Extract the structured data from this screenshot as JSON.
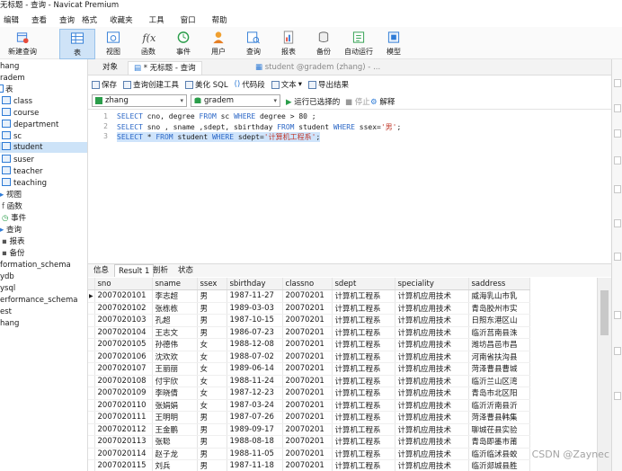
{
  "window": {
    "title": "无标题 - 查询 - Navicat Premium"
  },
  "menu": [
    "编辑",
    "查看",
    "查询",
    "格式",
    "收藏夹",
    "工具",
    "窗口",
    "帮助"
  ],
  "toolbar": {
    "new_query": "新建查询",
    "buttons": [
      "表",
      "视图",
      "函数",
      "事件",
      "用户",
      "查询",
      "报表",
      "备份",
      "自动运行",
      "模型"
    ]
  },
  "tree": {
    "items": [
      "zhang",
      "gradem",
      "表",
      "class",
      "course",
      "department",
      "sc",
      "student",
      "suser",
      "teacher",
      "teaching",
      "视图",
      "函数",
      "事件",
      "查询",
      "报表",
      "备份",
      "information_schema",
      "mydb",
      "mysql",
      "performance_schema",
      "test",
      "zhang"
    ],
    "shown": [
      "hang",
      "radem",
      "表",
      "class",
      "course",
      "department",
      "sc",
      "student",
      "suser",
      "teacher",
      "teaching",
      "视图",
      "函数",
      "事件",
      "查询",
      "报表",
      "备份",
      "formation_schema",
      "ydb",
      "ysql",
      "erformance_schema",
      "est",
      "hang"
    ]
  },
  "tabs": {
    "objects": "对象",
    "query": "* 无标题 - 查询",
    "table": "student @gradem (zhang) - ..."
  },
  "query_toolbar": {
    "save": "保存",
    "builder": "查询创建工具",
    "beautify": "美化 SQL",
    "snippet": "代码段",
    "text": "文本",
    "export": "导出结果"
  },
  "connection": {
    "conn": "zhang",
    "db": "gradem",
    "run": "运行已选择的",
    "stop": "停止",
    "explain": "解释"
  },
  "editor": {
    "lines": [
      {
        "n": "1",
        "text": "SELECT cno, degree FROM sc WHERE degree > 80 ;"
      },
      {
        "n": "2",
        "text": "SELECT sno , sname ,sdept, sbirthday FROM student WHERE ssex='男';"
      },
      {
        "n": "3",
        "text": "SELECT * FROM student WHERE sdept='计算机工程系';"
      }
    ]
  },
  "result_tabs": [
    "信息",
    "Result 1",
    "剖析",
    "状态"
  ],
  "grid": {
    "columns": [
      "sno",
      "sname",
      "ssex",
      "sbirthday",
      "classno",
      "sdept",
      "speciality",
      "saddress"
    ],
    "rows": [
      [
        "2007020101",
        "李志超",
        "男",
        "1987-11-27",
        "20070201",
        "计算机工程系",
        "计算机应用技术",
        "威海乳山市乳"
      ],
      [
        "2007020102",
        "张栋栋",
        "男",
        "1989-03-03",
        "20070201",
        "计算机工程系",
        "计算机应用技术",
        "青岛胶州市实"
      ],
      [
        "2007020103",
        "孔超",
        "男",
        "1987-10-15",
        "20070201",
        "计算机工程系",
        "计算机应用技术",
        "日照东港区山"
      ],
      [
        "2007020104",
        "王志文",
        "男",
        "1986-07-23",
        "20070201",
        "计算机工程系",
        "计算机应用技术",
        "临沂莒南县洙"
      ],
      [
        "2007020105",
        "孙德伟",
        "女",
        "1988-12-08",
        "20070201",
        "计算机工程系",
        "计算机应用技术",
        "潍坊昌邑市昌"
      ],
      [
        "2007020106",
        "沈欢欢",
        "女",
        "1988-07-02",
        "20070201",
        "计算机工程系",
        "计算机应用技术",
        "河南省扶沟县"
      ],
      [
        "2007020107",
        "王丽丽",
        "女",
        "1989-06-14",
        "20070201",
        "计算机工程系",
        "计算机应用技术",
        "菏泽曹县曹城"
      ],
      [
        "2007020108",
        "付宇欣",
        "女",
        "1988-11-24",
        "20070201",
        "计算机工程系",
        "计算机应用技术",
        "临沂兰山区湾"
      ],
      [
        "2007020109",
        "李晓倩",
        "女",
        "1987-12-23",
        "20070201",
        "计算机工程系",
        "计算机应用技术",
        "青岛市北区阳"
      ],
      [
        "2007020110",
        "张娟娟",
        "女",
        "1987-03-24",
        "20070201",
        "计算机工程系",
        "计算机应用技术",
        "临沂沂南县沂"
      ],
      [
        "2007020111",
        "王明明",
        "男",
        "1987-07-26",
        "20070201",
        "计算机工程系",
        "计算机应用技术",
        "菏泽曹县韩集"
      ],
      [
        "2007020112",
        "王金鹏",
        "男",
        "1989-09-17",
        "20070201",
        "计算机工程系",
        "计算机应用技术",
        "聊城茌县实验"
      ],
      [
        "2007020113",
        "张聪",
        "男",
        "1988-08-18",
        "20070201",
        "计算机工程系",
        "计算机应用技术",
        "青岛即墨市莆"
      ],
      [
        "2007020114",
        "赵子龙",
        "男",
        "1988-11-05",
        "20070201",
        "计算机工程系",
        "计算机应用技术",
        "临沂临沭县蛟"
      ],
      [
        "2007020115",
        "刘兵",
        "男",
        "1987-11-18",
        "20070201",
        "计算机工程系",
        "计算机应用技术",
        "临沂郯城县胜"
      ]
    ]
  },
  "watermark": "CSDN @Zaynec",
  "colors": {
    "keyword": "#2b67c6",
    "string": "#c0392b",
    "selection": "#cde3f8"
  }
}
